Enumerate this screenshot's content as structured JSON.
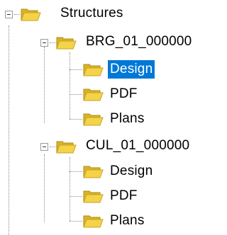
{
  "tree": {
    "root": {
      "label": "Structures",
      "icon": "folder-open-icon",
      "expanded": true,
      "children": [
        {
          "label": "BRG_01_000000",
          "icon": "folder-open-icon",
          "expanded": true,
          "children": [
            {
              "label": "Design",
              "icon": "folder-open-icon",
              "selected": true
            },
            {
              "label": "PDF",
              "icon": "folder-open-icon",
              "selected": false
            },
            {
              "label": "Plans",
              "icon": "folder-open-icon",
              "selected": false
            }
          ]
        },
        {
          "label": "CUL_01_000000",
          "icon": "folder-open-icon",
          "expanded": true,
          "children": [
            {
              "label": "Design",
              "icon": "folder-open-icon",
              "selected": false
            },
            {
              "label": "PDF",
              "icon": "folder-open-icon",
              "selected": false
            },
            {
              "label": "Plans",
              "icon": "folder-open-icon",
              "selected": false
            }
          ]
        }
      ]
    }
  },
  "colors": {
    "selection": "#0078d7",
    "folder_front": "#f4d349",
    "folder_back": "#d7b32a",
    "connector": "#8a8a8a"
  }
}
